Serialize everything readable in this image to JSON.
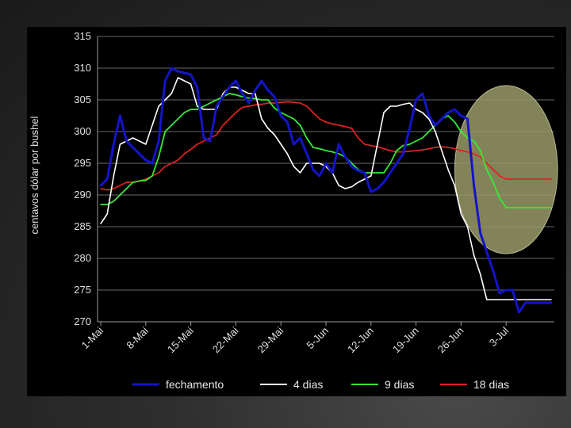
{
  "chart_data": {
    "type": "line",
    "title": "",
    "xlabel": "",
    "ylabel": "centavos dólar por bushel",
    "ylim": [
      270,
      315
    ],
    "yticks": [
      270,
      275,
      280,
      285,
      290,
      295,
      300,
      305,
      310,
      315
    ],
    "x_ticklabels": [
      "1-Mai",
      "8-Mai",
      "15-Mai",
      "22-Mai",
      "29-Mai",
      "5-Jun",
      "12-Jun",
      "19-Jun",
      "26-Jun",
      "3-Jul"
    ],
    "x_tick_days": [
      0,
      7,
      14,
      21,
      28,
      35,
      42,
      49,
      56,
      63
    ],
    "x_day_range": [
      -0.5,
      70.5
    ],
    "legend_position": "bottom",
    "annotation": "highlight ellipse around late June – early July",
    "series": [
      {
        "name": "fechamento",
        "color": "#1414c8",
        "x": [
          0,
          1,
          2,
          3,
          4,
          5,
          7,
          8,
          9,
          10,
          11,
          12,
          14,
          15,
          16,
          17,
          18,
          19,
          20,
          21,
          22,
          23,
          24,
          25,
          26,
          27,
          28,
          29,
          30,
          31,
          32,
          33,
          34,
          35,
          36,
          37,
          38,
          39,
          40,
          41,
          42,
          43,
          44,
          45,
          46,
          47,
          48,
          49,
          50,
          51,
          52,
          53,
          54,
          55,
          56,
          57,
          58,
          59,
          60,
          61,
          62,
          63,
          64,
          65,
          66,
          67,
          68,
          69,
          70
        ],
        "values": [
          291.5,
          292.5,
          298,
          302.5,
          298.5,
          297.5,
          295.5,
          295,
          298.5,
          308,
          310,
          309.5,
          309,
          307,
          299,
          298.5,
          304,
          305.5,
          307,
          308,
          306,
          304.5,
          306.5,
          308,
          306.5,
          305.5,
          302.5,
          301.5,
          298,
          299,
          296.5,
          294,
          293,
          295,
          293.5,
          298,
          296,
          294.5,
          293.8,
          293.5,
          290.5,
          291,
          292,
          293.5,
          295,
          296.5,
          300.5,
          305,
          306,
          302.5,
          301,
          302,
          303,
          303.5,
          302.5,
          302,
          291.5,
          284,
          281,
          278,
          274.5,
          275,
          275,
          271.5,
          273,
          273,
          273,
          273,
          273
        ]
      },
      {
        "name": "4 dias",
        "color": "#ffffff",
        "x": [
          0,
          1,
          2,
          3,
          4,
          5,
          7,
          8,
          9,
          10,
          11,
          12,
          14,
          15,
          16,
          17,
          18,
          19,
          20,
          21,
          22,
          23,
          24,
          25,
          26,
          27,
          28,
          29,
          30,
          31,
          32,
          33,
          34,
          35,
          36,
          37,
          38,
          39,
          40,
          41,
          42,
          43,
          44,
          45,
          46,
          47,
          48,
          49,
          50,
          51,
          52,
          53,
          54,
          55,
          56,
          57,
          58,
          59,
          60,
          61,
          62,
          63,
          64,
          65,
          66,
          67,
          68,
          69,
          70
        ],
        "values": [
          285.5,
          287,
          293,
          298,
          298.5,
          299,
          298,
          301,
          304,
          305,
          306,
          308.5,
          307.5,
          304,
          303.5,
          303.5,
          303.5,
          306,
          307,
          307,
          306.5,
          306,
          306,
          302,
          300.5,
          299.5,
          298,
          296.5,
          294.5,
          293.5,
          295,
          295,
          295,
          294.5,
          293.5,
          291.5,
          291,
          291.3,
          292,
          292.5,
          293,
          298,
          303,
          304,
          304,
          304.3,
          304.5,
          303.5,
          303,
          302,
          300,
          297,
          294,
          291.5,
          287,
          285,
          280.5,
          277.5,
          273.5,
          273.5,
          273.5,
          273.5,
          273.5,
          273.5,
          273.5,
          273.5,
          273.5,
          273.5,
          273.5
        ]
      },
      {
        "name": "9 dias",
        "color": "#33ee33",
        "x": [
          0,
          1,
          2,
          3,
          4,
          5,
          6,
          7,
          8,
          9,
          10,
          11,
          12,
          13,
          14,
          15,
          16,
          17,
          18,
          19,
          20,
          21,
          22,
          23,
          24,
          25,
          26,
          27,
          28,
          29,
          30,
          31,
          32,
          33,
          34,
          35,
          36,
          37,
          38,
          39,
          40,
          41,
          42,
          43,
          44,
          45,
          46,
          47,
          48,
          49,
          50,
          51,
          52,
          53,
          54,
          55,
          56,
          57,
          58,
          59,
          60,
          61,
          62,
          63,
          64,
          65,
          66,
          67,
          68,
          69,
          70
        ],
        "values": [
          288.5,
          288.5,
          289,
          290,
          291,
          292,
          292.2,
          292.3,
          293,
          296,
          300,
          301,
          302,
          303,
          303.5,
          303.5,
          304,
          304.5,
          305,
          305.5,
          306,
          305.8,
          305.5,
          305.3,
          305.2,
          305,
          305,
          303.7,
          303,
          302.5,
          302,
          301,
          299,
          297.5,
          297.3,
          297,
          296.8,
          296.5,
          296,
          295,
          294,
          293.5,
          293.5,
          293.5,
          293.5,
          295,
          297,
          297.8,
          298,
          298.5,
          299,
          300,
          301,
          302,
          302.5,
          301.5,
          300,
          299,
          298.5,
          297,
          294,
          292,
          289.5,
          288,
          288,
          288,
          288,
          288,
          288,
          288,
          288
        ]
      },
      {
        "name": "18 dias",
        "color": "#dd2222",
        "x": [
          0,
          1,
          2,
          3,
          4,
          5,
          6,
          7,
          8,
          9,
          10,
          11,
          12,
          13,
          14,
          15,
          16,
          17,
          18,
          19,
          20,
          21,
          22,
          23,
          24,
          25,
          26,
          27,
          28,
          29,
          30,
          31,
          32,
          33,
          34,
          35,
          36,
          37,
          38,
          39,
          40,
          41,
          42,
          43,
          44,
          45,
          46,
          47,
          48,
          49,
          50,
          51,
          52,
          53,
          54,
          55,
          56,
          57,
          58,
          59,
          60,
          61,
          62,
          63,
          64,
          65,
          66,
          67,
          68,
          69,
          70
        ],
        "values": [
          291,
          290.8,
          291,
          291.5,
          292,
          292,
          292.2,
          292.5,
          293,
          293.5,
          294.5,
          295,
          295.5,
          296.5,
          297.2,
          298,
          298.5,
          299,
          299.5,
          301,
          302,
          303,
          303.8,
          304,
          304.2,
          304.3,
          304.5,
          304.5,
          304.6,
          304.7,
          304.6,
          304.5,
          304,
          303,
          302,
          301.5,
          301.2,
          301,
          300.8,
          300.5,
          299,
          298,
          297.8,
          297.6,
          297.3,
          297,
          296.8,
          296.8,
          296.9,
          297,
          297.1,
          297.3,
          297.5,
          297.6,
          297.5,
          297.3,
          297,
          296.8,
          296.5,
          296,
          295,
          294,
          293,
          292.5,
          292.5,
          292.5,
          292.5,
          292.5,
          292.5,
          292.5,
          292.5
        ]
      }
    ]
  }
}
